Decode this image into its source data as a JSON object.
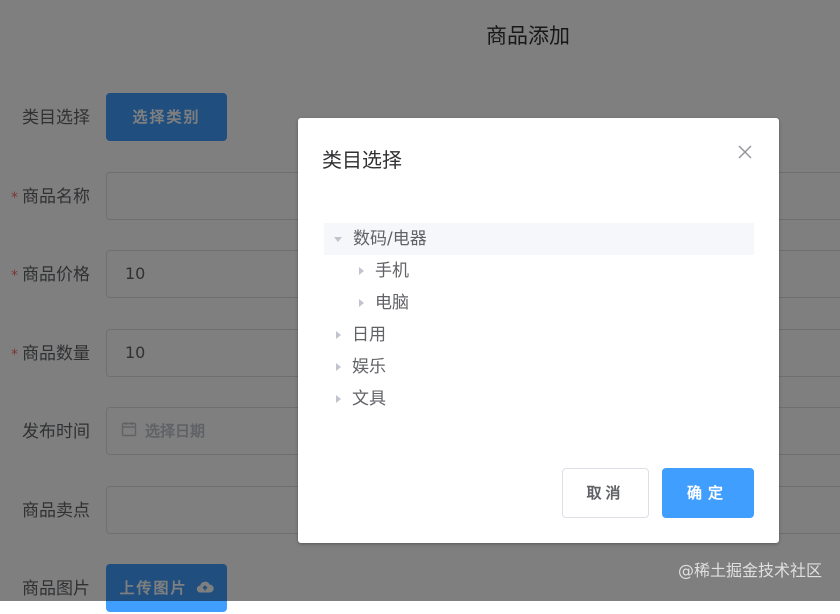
{
  "page": {
    "title": "商品添加",
    "form": {
      "category": {
        "label": "类目选择",
        "button": "选择类别"
      },
      "name": {
        "label": "商品名称",
        "required": true,
        "value": ""
      },
      "price": {
        "label": "商品价格",
        "required": true,
        "value": "10"
      },
      "quantity": {
        "label": "商品数量",
        "required": true,
        "value": "10"
      },
      "publish_time": {
        "label": "发布时间",
        "placeholder": "选择日期",
        "icon": "calendar-icon"
      },
      "selling_point": {
        "label": "商品卖点",
        "value": ""
      },
      "image": {
        "label": "商品图片",
        "button": "上传图片",
        "icon": "cloud-upload-icon"
      }
    }
  },
  "dialog": {
    "title": "类目选择",
    "close_icon": "close-icon",
    "tree": [
      {
        "label": "数码/电器",
        "expanded": true,
        "children": [
          {
            "label": "手机"
          },
          {
            "label": "电脑"
          }
        ]
      },
      {
        "label": "日用",
        "expanded": false
      },
      {
        "label": "娱乐",
        "expanded": false
      },
      {
        "label": "文具",
        "expanded": false
      }
    ],
    "cancel_label": "取消",
    "confirm_label": "确定"
  },
  "watermark": "@稀土掘金技术社区",
  "colors": {
    "primary": "#409eff",
    "required": "#f56c6c",
    "overlay": "rgba(0,0,0,0.5)"
  }
}
